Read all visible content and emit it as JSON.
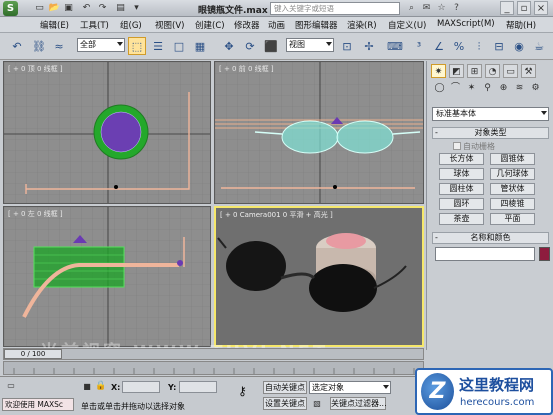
{
  "window": {
    "title": "眼镜瓶文件.max",
    "search_placeholder": "键入关键字或短语"
  },
  "menu": [
    "编辑(E)",
    "工具(T)",
    "组(G)",
    "视图(V)",
    "创建(C)",
    "修改器",
    "动画",
    "图形编辑器",
    "渲染(R)",
    "自定义(U)",
    "MAXScript(M)",
    "帮助(H)"
  ],
  "toolbar": {
    "selection_filter": "全部",
    "reference_coord": "视图"
  },
  "viewports": {
    "top_left": "[ + 0 顶 0 线框 ]",
    "top_right": "[ + 0 前 0 线框 ]",
    "bottom_left": "[ + 0 左 0 线框 ]",
    "bottom_right": "[ + 0 Camera001 0 平滑 + 高光 ]"
  },
  "command_panel": {
    "category": "标准基本体",
    "object_type_title": "对象类型",
    "auto_grid": "自动栅格",
    "primitives": [
      "长方体",
      "圆锥体",
      "球体",
      "几何球体",
      "圆柱体",
      "管状体",
      "圆环",
      "四棱锥",
      "茶壶",
      "平面"
    ],
    "name_color_title": "名称和颜色",
    "object_color": "#8e1c3e"
  },
  "time_slider": {
    "frame_display": "0 / 100"
  },
  "status": {
    "listener_text": "欢迎使用 MAXSc",
    "prompt": "单击或单击并拖动以选择对象",
    "x_label": "X:",
    "y_label": "Y:",
    "auto_key": "自动关键点",
    "set_key": "设置关键点",
    "selected_dd": "选定对象",
    "key_filters": "关键点过滤器..."
  },
  "watermark": {
    "site_name": "这里教程网",
    "site_url": "herecours.com",
    "overlay": "当前视窗 WWW.TUVI.NET"
  }
}
